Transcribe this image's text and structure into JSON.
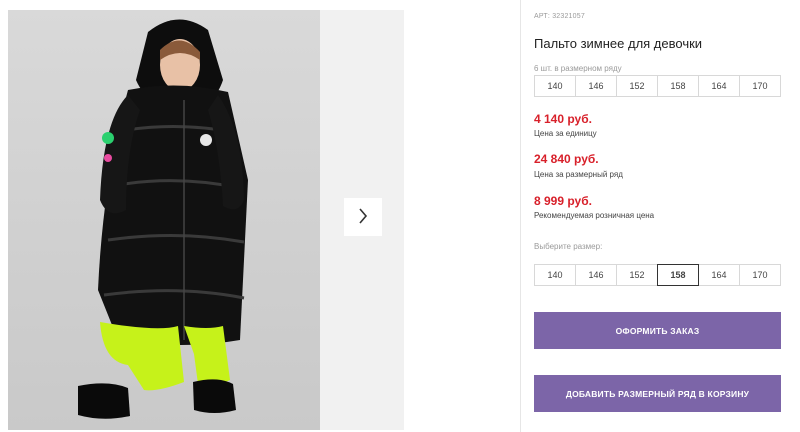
{
  "product": {
    "article": "АРТ: 32321057",
    "title": "Пальто зимнее для девочки",
    "size_row_note": "6 шт. в размерном ряду",
    "size_row": [
      "140",
      "146",
      "152",
      "158",
      "164",
      "170"
    ]
  },
  "prices": [
    {
      "value": "4 140 руб.",
      "label": "Цена за единицу"
    },
    {
      "value": "24 840 руб.",
      "label": "Цена за размерный ряд"
    },
    {
      "value": "8 999 руб.",
      "label": "Рекомендуемая розничная цена"
    }
  ],
  "size_picker": {
    "label": "Выберите размер:",
    "options": [
      "140",
      "146",
      "152",
      "158",
      "164",
      "170"
    ],
    "selected": "158"
  },
  "actions": {
    "order_label": "ОФОРМИТЬ ЗАКАЗ",
    "add_row_label": "ДОБАВИТЬ РАЗМЕРНЫЙ РЯД В КОРЗИНУ"
  },
  "colors": {
    "price_red": "#d8202a",
    "button_purple": "#7c65a8"
  },
  "icons": {
    "next": "chevron-right-icon"
  }
}
